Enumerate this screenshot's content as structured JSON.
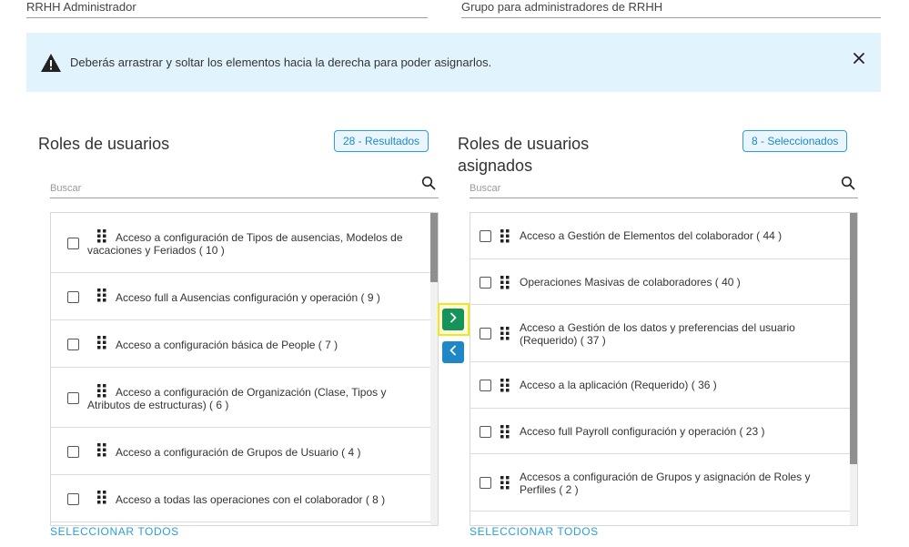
{
  "top_fields": {
    "name_value": "RRHH Administrador",
    "description_value": "Grupo para administradores de RRHH"
  },
  "alert": {
    "icon": "warning-icon",
    "message": "Deberás arrastrar y soltar los elementos hacia la derecha para poder asignarlos.",
    "close_icon": "close-icon"
  },
  "left_panel": {
    "title": "Roles de usuarios",
    "badge": "28 - Resultados",
    "search_placeholder": "Buscar",
    "select_all": "SELECCIONAR TODOS",
    "items": [
      {
        "label": "Acceso a configuración de Tipos de ausencias, Modelos de vacaciones y Feriados ( 10 )"
      },
      {
        "label": "Acceso full a Ausencias configuración y operación ( 9 )"
      },
      {
        "label": "Acceso a configuración básica de People ( 7 )"
      },
      {
        "label": "Acceso a configuración de Organización (Clase, Tipos y Atributos de estructuras) ( 6 )"
      },
      {
        "label": "Acceso a configuración de Grupos de Usuario ( 4 )"
      },
      {
        "label": "Acceso a todas las operaciones con el colaborador ( 8 )"
      }
    ]
  },
  "right_panel": {
    "title": "Roles de usuarios asignados",
    "badge": "8 - Seleccionados",
    "search_placeholder": "Buscar",
    "select_all": "SELECCIONAR TODOS",
    "items": [
      {
        "label": "Acceso a Gestión de Elementos del colaborador ( 44 )"
      },
      {
        "label": "Operaciones Masivas de colaboradores ( 40 )"
      },
      {
        "label": "Acceso a Gestión de los datos y preferencias del usuario (Requerido) ( 37 )"
      },
      {
        "label": "Acceso a la aplicación (Requerido) ( 36 )"
      },
      {
        "label": "Acceso full Payroll configuración y operación ( 23 )"
      },
      {
        "label": "Accesos a configuración de Grupos y asignación de Roles y Perfiles ( 2 )"
      }
    ]
  },
  "transfer_buttons": {
    "move_right_icon": "chevron-right-icon",
    "move_left_icon": "chevron-left-icon"
  },
  "colors": {
    "alert_bg": "#e1f4fd",
    "accent_blue": "#2a9fd8",
    "move_right_green": "#15935a",
    "move_left_blue": "#1e88c7",
    "highlight_yellow": "#f4e41b"
  }
}
